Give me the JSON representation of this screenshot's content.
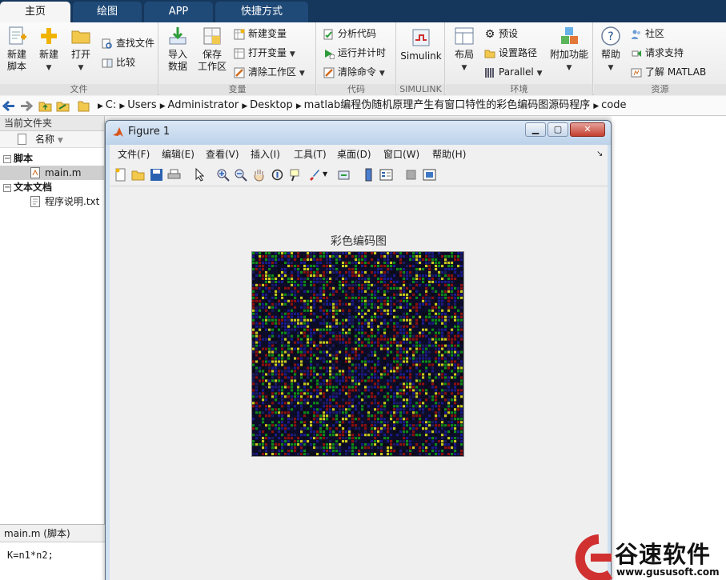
{
  "tabs": [
    "主页",
    "绘图",
    "APP",
    "快捷方式"
  ],
  "ribbon": {
    "file": {
      "new_script": "新建\n脚本",
      "new": "新建",
      "open": "打开",
      "find_files": "查找文件",
      "compare": "比较",
      "label": "文件"
    },
    "variable": {
      "import": "导入\n数据",
      "save_ws": "保存\n工作区",
      "new_var": "新建变量",
      "open_var": "打开变量",
      "clear_ws": "清除工作区",
      "label": "变量"
    },
    "code": {
      "analyze": "分析代码",
      "run_time": "运行并计时",
      "clear_cmd": "清除命令",
      "label": "代码"
    },
    "simulink": {
      "btn": "Simulink",
      "label": "SIMULINK"
    },
    "env": {
      "layout": "布局",
      "prefs": "预设",
      "set_path": "设置路径",
      "parallel": "Parallel",
      "addons": "附加功能",
      "label": "环境"
    },
    "resources": {
      "help": "帮助",
      "community": "社区",
      "support": "请求支持",
      "learn": "了解 MATLAB",
      "label": "资源"
    }
  },
  "address": {
    "parts": [
      "C:",
      "Users",
      "Administrator",
      "Desktop",
      "matlab编程伪随机原理产生有窗口特性的彩色编码图源码程序",
      "code"
    ]
  },
  "left": {
    "title": "当前文件夹",
    "col_name": "名称",
    "group_scripts": "脚本",
    "file_main": "main.m",
    "group_text": "文本文档",
    "file_txt": "程序说明.txt",
    "detail_title": "main.m  (脚本)",
    "detail_code": "K=n1*n2;"
  },
  "figure": {
    "title": "Figure 1",
    "menus": [
      "文件(F)",
      "编辑(E)",
      "查看(V)",
      "插入(I)",
      "工具(T)",
      "桌面(D)",
      "窗口(W)",
      "帮助(H)"
    ],
    "plot_title": "彩色编码图"
  },
  "watermark": {
    "name": "谷速软件",
    "url": "www.gususoft.com"
  },
  "colors": {
    "tabbar": "#16375c",
    "accent": "#d03030"
  }
}
